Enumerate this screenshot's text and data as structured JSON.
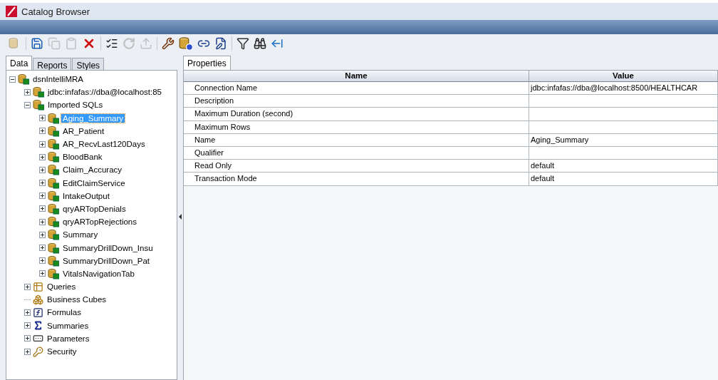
{
  "window": {
    "title": "Catalog Browser"
  },
  "toolbar": [
    [
      {
        "kind": "database",
        "disabled": true
      }
    ],
    [
      {
        "kind": "save",
        "disabled": false
      },
      {
        "kind": "copy",
        "disabled": true
      },
      {
        "kind": "paste",
        "disabled": true
      },
      {
        "kind": "delete",
        "disabled": false
      }
    ],
    [
      {
        "kind": "checklist",
        "disabled": false
      },
      {
        "kind": "refresh",
        "disabled": true
      },
      {
        "kind": "upload",
        "disabled": true
      }
    ],
    [
      {
        "kind": "tools",
        "disabled": false
      },
      {
        "kind": "database-settings",
        "disabled": false
      },
      {
        "kind": "link",
        "disabled": false
      },
      {
        "kind": "edit",
        "disabled": false
      }
    ],
    [
      {
        "kind": "filter",
        "disabled": false
      },
      {
        "kind": "binoculars",
        "disabled": false
      },
      {
        "kind": "back",
        "disabled": false
      }
    ]
  ],
  "left_tabs": [
    {
      "label": "Data",
      "selected": true
    },
    {
      "label": "Reports",
      "selected": false
    },
    {
      "label": "Styles",
      "selected": false
    }
  ],
  "tree": [
    {
      "label": "dsnIntelliMRA",
      "kind": "datasource",
      "expanded": true,
      "selected": false,
      "children": [
        {
          "label": "jdbc:infafas://dba@localhost:85",
          "kind": "connection",
          "expanded": false,
          "selected": false
        },
        {
          "label": "Imported SQLs",
          "kind": "sql",
          "expanded": true,
          "selected": false,
          "children": [
            {
              "label": "Aging_Summary",
              "kind": "sql",
              "expanded": false,
              "selected": true
            },
            {
              "label": "AR_Patient",
              "kind": "sql",
              "expanded": false,
              "selected": false
            },
            {
              "label": "AR_RecvLast120Days",
              "kind": "sql",
              "expanded": false,
              "selected": false
            },
            {
              "label": "BloodBank",
              "kind": "sql",
              "expanded": false,
              "selected": false
            },
            {
              "label": "Claim_Accuracy",
              "kind": "sql",
              "expanded": false,
              "selected": false
            },
            {
              "label": "EditClaimService",
              "kind": "sql",
              "expanded": false,
              "selected": false
            },
            {
              "label": "IntakeOutput",
              "kind": "sql",
              "expanded": false,
              "selected": false
            },
            {
              "label": "qryARTopDenials",
              "kind": "sql",
              "expanded": false,
              "selected": false
            },
            {
              "label": "qryARTopRejections",
              "kind": "sql",
              "expanded": false,
              "selected": false
            },
            {
              "label": "Summary",
              "kind": "sql",
              "expanded": false,
              "selected": false
            },
            {
              "label": "SummaryDrillDown_Insu",
              "kind": "sql",
              "expanded": false,
              "selected": false
            },
            {
              "label": "SummaryDrillDown_Pat",
              "kind": "sql",
              "expanded": false,
              "selected": false
            },
            {
              "label": "VitalsNavigationTab",
              "kind": "sql",
              "expanded": false,
              "selected": false
            }
          ]
        },
        {
          "label": "Queries",
          "kind": "queries",
          "expanded": false,
          "selected": false
        },
        {
          "label": "Business Cubes",
          "kind": "cubes",
          "selected": false
        },
        {
          "label": "Formulas",
          "kind": "formulas",
          "expanded": false,
          "selected": false
        },
        {
          "label": "Summaries",
          "kind": "summaries",
          "expanded": false,
          "selected": false
        },
        {
          "label": "Parameters",
          "kind": "parameters",
          "expanded": false,
          "selected": false
        },
        {
          "label": "Security",
          "kind": "security",
          "expanded": false,
          "selected": false
        }
      ]
    }
  ],
  "right_tabs": [
    {
      "label": "Properties",
      "selected": true
    }
  ],
  "table": {
    "columns": [
      "Name",
      "Value"
    ],
    "rows": [
      [
        "Connection Name",
        "jdbc:infafas://dba@localhost:8500/HEALTHCAR"
      ],
      [
        "Description",
        ""
      ],
      [
        "Maximum Duration (second)",
        ""
      ],
      [
        "Maximum Rows",
        ""
      ],
      [
        "Name",
        "Aging_Summary"
      ],
      [
        "Qualifier",
        ""
      ],
      [
        "Read Only",
        "default"
      ],
      [
        "Transaction Mode",
        "default"
      ]
    ]
  }
}
